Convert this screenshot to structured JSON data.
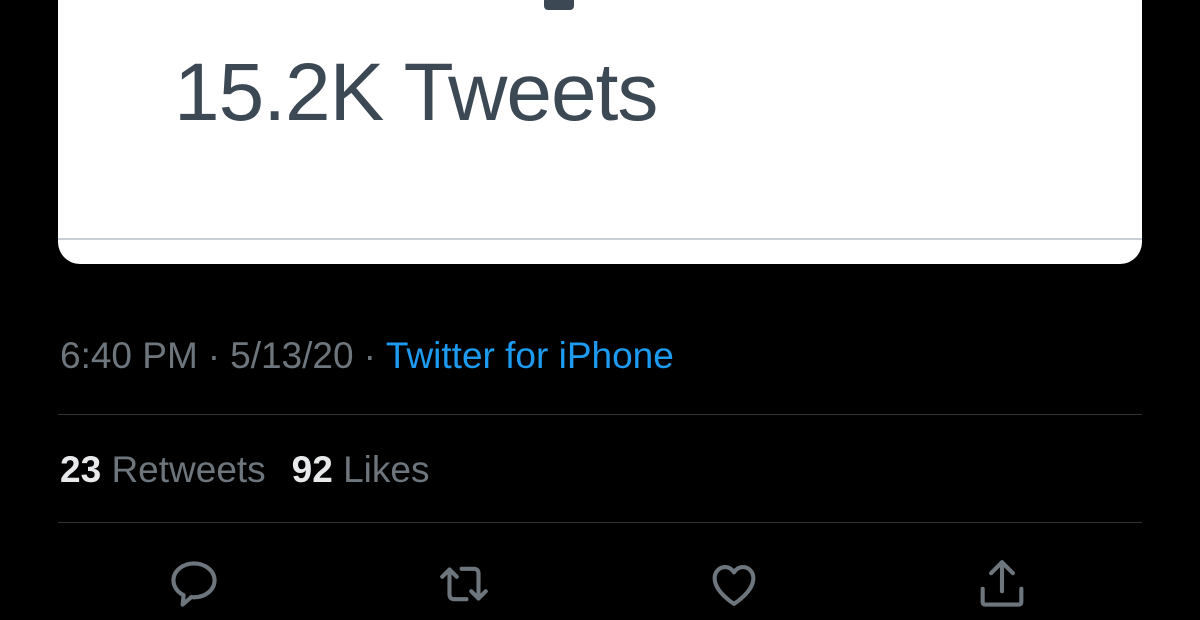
{
  "card": {
    "tweet_count": "15.2K Tweets"
  },
  "tweet_meta": {
    "time": "6:40 PM",
    "separator": "·",
    "date": "5/13/20",
    "source": "Twitter for iPhone"
  },
  "stats": {
    "retweets_count": "23",
    "retweets_label": "Retweets",
    "likes_count": "92",
    "likes_label": "Likes"
  },
  "actions": {
    "reply_icon": "speech-bubble-icon",
    "retweet_icon": "retweet-arrows-icon",
    "like_icon": "heart-icon",
    "share_icon": "share-upload-icon"
  },
  "colors": {
    "background": "#000000",
    "muted_text": "#6e767d",
    "link": "#1d9bf0",
    "count_text": "#e7e9ea",
    "card_text": "#3d4855"
  }
}
